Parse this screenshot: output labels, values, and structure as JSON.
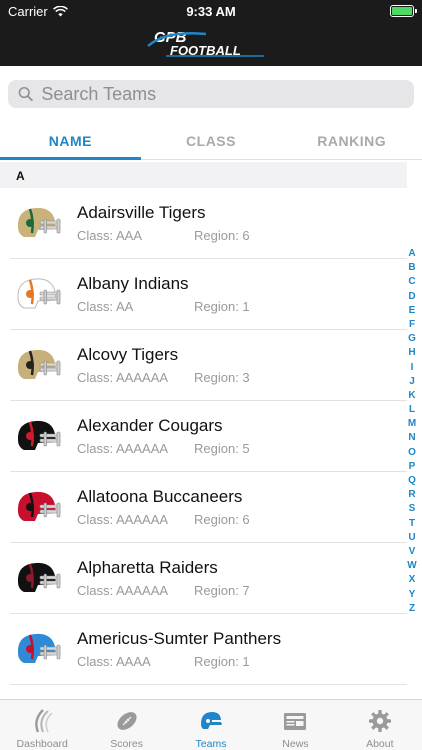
{
  "status_bar": {
    "carrier": "Carrier",
    "time": "9:33 AM"
  },
  "brand": {
    "logo_text": "GPB FOOTBALL"
  },
  "search": {
    "placeholder": "Search Teams"
  },
  "tabs": [
    {
      "label": "NAME",
      "active": true
    },
    {
      "label": "CLASS",
      "active": false
    },
    {
      "label": "RANKING",
      "active": false
    }
  ],
  "section": {
    "letter": "A"
  },
  "teams": [
    {
      "name": "Adairsville Tigers",
      "class": "Class: AAA",
      "region": "Region: 6",
      "helmet_color": "#c9b37a",
      "accent": "#1a6b3c"
    },
    {
      "name": "Albany Indians",
      "class": "Class: AA",
      "region": "Region: 1",
      "helmet_color": "#ffffff",
      "accent": "#e87722"
    },
    {
      "name": "Alcovy Tigers",
      "class": "Class: AAAAAA",
      "region": "Region: 3",
      "helmet_color": "#c7b07a",
      "accent": "#222222"
    },
    {
      "name": "Alexander Cougars",
      "class": "Class: AAAAAA",
      "region": "Region: 5",
      "helmet_color": "#111111",
      "accent": "#d31a2b"
    },
    {
      "name": "Allatoona Buccaneers",
      "class": "Class: AAAAAA",
      "region": "Region: 6",
      "helmet_color": "#c8102e",
      "accent": "#111111"
    },
    {
      "name": "Alpharetta Raiders",
      "class": "Class: AAAAAA",
      "region": "Region: 7",
      "helmet_color": "#111111",
      "accent": "#8b1a2b"
    },
    {
      "name": "Americus-Sumter Panthers",
      "class": "Class: AAAA",
      "region": "Region: 1",
      "helmet_color": "#2f8bd8",
      "accent": "#c8102e"
    }
  ],
  "alphabet": [
    "A",
    "B",
    "C",
    "D",
    "E",
    "F",
    "G",
    "H",
    "I",
    "J",
    "K",
    "L",
    "M",
    "N",
    "O",
    "P",
    "Q",
    "R",
    "S",
    "T",
    "U",
    "V",
    "W",
    "X",
    "Y",
    "Z"
  ],
  "tabbar": [
    {
      "label": "Dashboard",
      "icon": "dashboard-swoosh-icon",
      "active": false
    },
    {
      "label": "Scores",
      "icon": "football-icon",
      "active": false
    },
    {
      "label": "Teams",
      "icon": "helmet-icon",
      "active": true
    },
    {
      "label": "News",
      "icon": "newspaper-icon",
      "active": false
    },
    {
      "label": "About",
      "icon": "gear-icon",
      "active": false
    }
  ],
  "colors": {
    "accent": "#1f86c8",
    "header_bg": "#1b1b1b"
  }
}
